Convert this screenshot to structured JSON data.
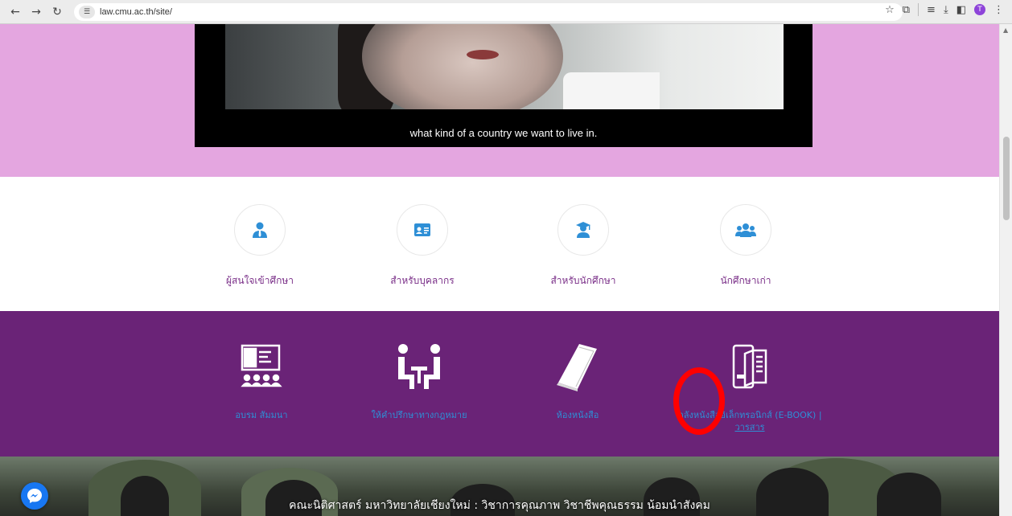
{
  "browser": {
    "back_icon": "arrow-left-icon",
    "forward_icon": "arrow-right-icon",
    "reload_icon": "reload-icon",
    "url": "law.cmu.ac.th/site/",
    "profile_initial": "T"
  },
  "video": {
    "subtitle": "what kind of a country we want to live in."
  },
  "quick_links": [
    {
      "label": "ผู้สนใจเข้าศึกษา",
      "icon": "user-tie-icon"
    },
    {
      "label": "สำหรับบุคลากร",
      "icon": "id-card-icon"
    },
    {
      "label": "สำหรับนักศึกษา",
      "icon": "graduate-icon"
    },
    {
      "label": "นักศึกษาเก่า",
      "icon": "users-icon"
    }
  ],
  "services": [
    {
      "label": "อบรม สัมมนา",
      "icon": "seminar-icon"
    },
    {
      "label": "ให้คำปรึกษาทางกฎหมาย",
      "icon": "consultation-icon"
    },
    {
      "label": "ห้องหนังสือ",
      "icon": "book-icon"
    },
    {
      "label": "คลังหนังสืออิเล็กทรอนิกส์ (E-BOOK)",
      "link_separator": "|",
      "link_label": "วารสาร",
      "icon": "ebook-icon"
    }
  ],
  "banner": {
    "text": "คณะนิติศาสตร์ มหาวิทยาลัยเชียงใหม่ : วิชาการคุณภาพ วิชาชีพคุณธรรม น้อมนำสังคม"
  },
  "colors": {
    "pink_section": "#e4a6e0",
    "purple_section": "#6a2377",
    "accent_blue": "#2e8fd6",
    "annotation_red": "#ff0000"
  }
}
